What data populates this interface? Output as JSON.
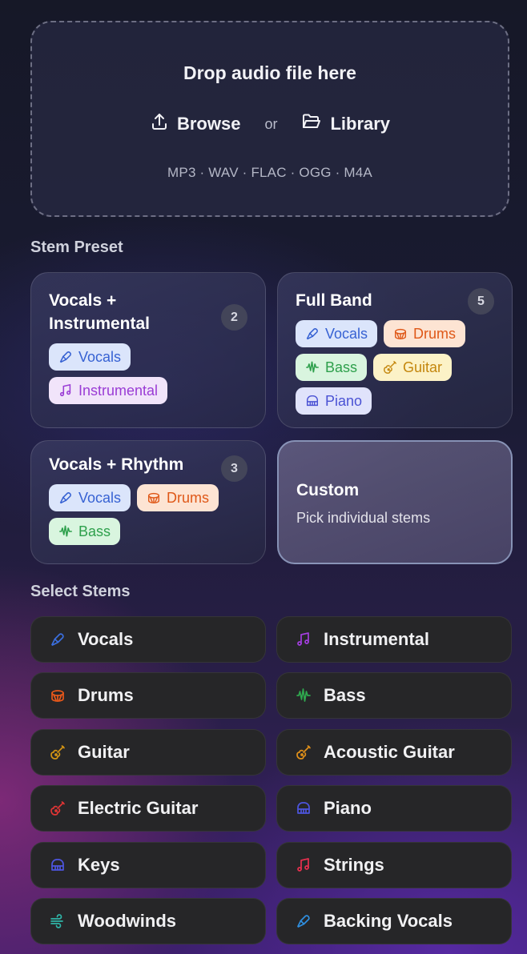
{
  "dropzone": {
    "title": "Drop audio file here",
    "browse_label": "Browse",
    "or_label": "or",
    "library_label": "Library",
    "formats": "MP3 · WAV · FLAC · OGG · M4A"
  },
  "presets_section": {
    "title": "Stem Preset",
    "presets": [
      {
        "title": "Vocals + Instrumental",
        "count": "2",
        "chips": [
          "Vocals",
          "Instrumental"
        ]
      },
      {
        "title": "Full Band",
        "count": "5",
        "chips": [
          "Vocals",
          "Drums",
          "Bass",
          "Guitar",
          "Piano"
        ]
      },
      {
        "title": "Vocals + Rhythm",
        "count": "3",
        "chips": [
          "Vocals",
          "Drums",
          "Bass"
        ]
      }
    ],
    "custom": {
      "title": "Custom",
      "subtitle": "Pick individual stems"
    }
  },
  "stems_section": {
    "title": "Select Stems",
    "stems": [
      {
        "label": "Vocals",
        "icon": "microphone-icon",
        "color": "#3b6fe0"
      },
      {
        "label": "Instrumental",
        "icon": "music-note-icon",
        "color": "#a43fe0"
      },
      {
        "label": "Drums",
        "icon": "drum-icon",
        "color": "#e8581a"
      },
      {
        "label": "Bass",
        "icon": "waveform-icon",
        "color": "#2fa84e"
      },
      {
        "label": "Guitar",
        "icon": "guitar-icon",
        "color": "#d49514"
      },
      {
        "label": "Acoustic Guitar",
        "icon": "guitar-icon",
        "color": "#e0901a"
      },
      {
        "label": "Electric Guitar",
        "icon": "guitar-icon",
        "color": "#e03535"
      },
      {
        "label": "Piano",
        "icon": "piano-icon",
        "color": "#4d55e0"
      },
      {
        "label": "Keys",
        "icon": "piano-icon",
        "color": "#4d55e0"
      },
      {
        "label": "Strings",
        "icon": "music-note-icon",
        "color": "#e8304f"
      },
      {
        "label": "Woodwinds",
        "icon": "wind-icon",
        "color": "#2fb5a8"
      },
      {
        "label": "Backing Vocals",
        "icon": "microphone-icon",
        "color": "#2f8fe0"
      }
    ]
  }
}
